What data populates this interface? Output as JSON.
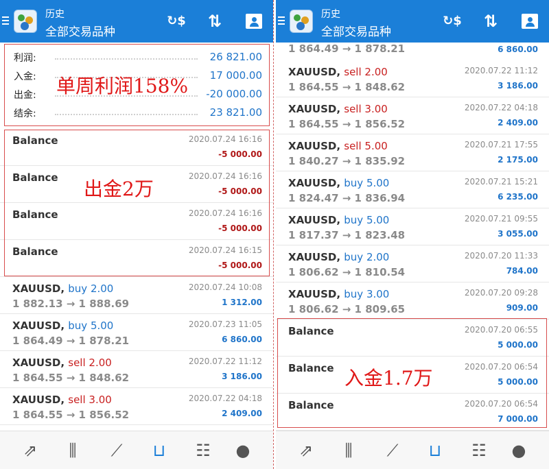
{
  "left": {
    "header": {
      "title": "历史",
      "subtitle": "全部交易品种"
    },
    "summary": [
      {
        "label": "利润:",
        "value": "26 821.00"
      },
      {
        "label": "入金:",
        "value": "17 000.00"
      },
      {
        "label": "出金:",
        "value": "-20 000.00"
      },
      {
        "label": "结余:",
        "value": "23 821.00"
      }
    ],
    "deals": [
      {
        "symbol": "Balance",
        "action": "",
        "prices": "",
        "time": "2020.07.24 16:16",
        "profit": "-5 000.00",
        "negative": true
      },
      {
        "symbol": "Balance",
        "action": "",
        "prices": "",
        "time": "2020.07.24 16:16",
        "profit": "-5 000.00",
        "negative": true
      },
      {
        "symbol": "Balance",
        "action": "",
        "prices": "",
        "time": "2020.07.24 16:16",
        "profit": "-5 000.00",
        "negative": true
      },
      {
        "symbol": "Balance",
        "action": "",
        "prices": "",
        "time": "2020.07.24 16:15",
        "profit": "-5 000.00",
        "negative": true
      },
      {
        "symbol": "XAUUSD,",
        "action": "buy 2.00",
        "prices": "1 882.13 → 1 888.69",
        "time": "2020.07.24 10:08",
        "profit": "1 312.00",
        "negative": false
      },
      {
        "symbol": "XAUUSD,",
        "action": "buy 5.00",
        "prices": "1 864.49 → 1 878.21",
        "time": "2020.07.23 11:05",
        "profit": "6 860.00",
        "negative": false
      },
      {
        "symbol": "XAUUSD,",
        "action": "sell 2.00",
        "prices": "1 864.55 → 1 848.62",
        "time": "2020.07.22 11:12",
        "profit": "3 186.00",
        "negative": false
      },
      {
        "symbol": "XAUUSD,",
        "action": "sell 3.00",
        "prices": "1 864.55 → 1 856.52",
        "time": "2020.07.22 04:18",
        "profit": "2 409.00",
        "negative": false
      }
    ],
    "annotations": {
      "profit_note": "单周利润158%",
      "withdraw_note": "出金2万"
    }
  },
  "right": {
    "header": {
      "title": "历史",
      "subtitle": "全部交易品种"
    },
    "partial_top": {
      "prices": "1 864.49 → 1 878.21",
      "profit": "6 860.00"
    },
    "deals": [
      {
        "symbol": "XAUUSD,",
        "action": "sell 2.00",
        "prices": "1 864.55 → 1 848.62",
        "time": "2020.07.22 11:12",
        "profit": "3 186.00",
        "negative": false
      },
      {
        "symbol": "XAUUSD,",
        "action": "sell 3.00",
        "prices": "1 864.55 → 1 856.52",
        "time": "2020.07.22 04:18",
        "profit": "2 409.00",
        "negative": false
      },
      {
        "symbol": "XAUUSD,",
        "action": "sell 5.00",
        "prices": "1 840.27 → 1 835.92",
        "time": "2020.07.21 17:55",
        "profit": "2 175.00",
        "negative": false
      },
      {
        "symbol": "XAUUSD,",
        "action": "buy 5.00",
        "prices": "1 824.47 → 1 836.94",
        "time": "2020.07.21 15:21",
        "profit": "6 235.00",
        "negative": false
      },
      {
        "symbol": "XAUUSD,",
        "action": "buy 5.00",
        "prices": "1 817.37 → 1 823.48",
        "time": "2020.07.21 09:55",
        "profit": "3 055.00",
        "negative": false
      },
      {
        "symbol": "XAUUSD,",
        "action": "buy 2.00",
        "prices": "1 806.62 → 1 810.54",
        "time": "2020.07.20 11:33",
        "profit": "784.00",
        "negative": false
      },
      {
        "symbol": "XAUUSD,",
        "action": "buy 3.00",
        "prices": "1 806.62 → 1 809.65",
        "time": "2020.07.20 09:28",
        "profit": "909.00",
        "negative": false
      },
      {
        "symbol": "Balance",
        "action": "",
        "prices": "",
        "time": "2020.07.20 06:55",
        "profit": "5 000.00",
        "negative": false
      },
      {
        "symbol": "Balance",
        "action": "",
        "prices": "",
        "time": "2020.07.20 06:54",
        "profit": "5 000.00",
        "negative": false
      },
      {
        "symbol": "Balance",
        "action": "",
        "prices": "",
        "time": "2020.07.20 06:54",
        "profit": "7 000.00",
        "negative": false
      }
    ],
    "annotations": {
      "deposit_note": "入金1.7万"
    }
  },
  "nav": {
    "items": [
      {
        "icon": "quotes-icon",
        "glyph": "⇗"
      },
      {
        "icon": "chart-icon",
        "glyph": "⫼"
      },
      {
        "icon": "trade-icon",
        "glyph": "⟋"
      },
      {
        "icon": "history-icon",
        "glyph": "⊔"
      },
      {
        "icon": "news-icon",
        "glyph": "☷"
      },
      {
        "icon": "chat-icon",
        "glyph": "●"
      }
    ],
    "active_index": 3
  },
  "colors": {
    "header": "#1b7fd8",
    "buy": "#1f74c9",
    "sell": "#c81f1f",
    "annotation": "#e01818"
  }
}
